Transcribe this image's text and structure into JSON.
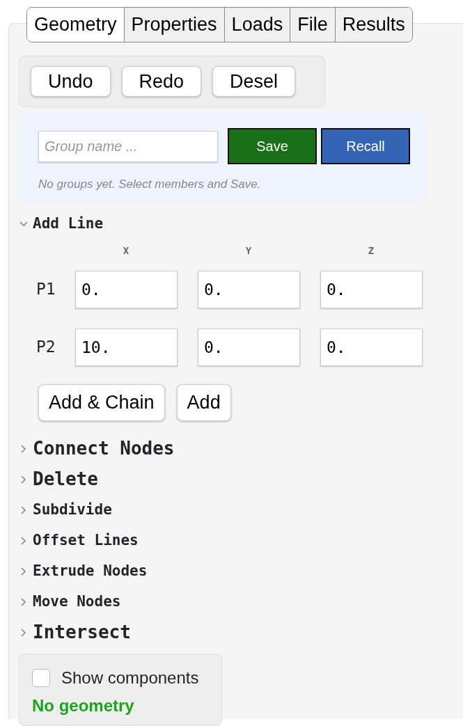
{
  "tabs": [
    {
      "label": "Geometry",
      "selected": true
    },
    {
      "label": "Properties",
      "selected": false
    },
    {
      "label": "Loads",
      "selected": false
    },
    {
      "label": "File",
      "selected": false
    },
    {
      "label": "Results",
      "selected": false
    }
  ],
  "history_buttons": [
    "Undo",
    "Redo",
    "Desel"
  ],
  "groups": {
    "placeholder": "Group name ...",
    "save": "Save",
    "recall": "Recall",
    "hint": "No groups yet. Select members and Save."
  },
  "add_line": {
    "title": "Add Line",
    "expanded": true,
    "columns": [
      "X",
      "Y",
      "Z"
    ],
    "points": [
      {
        "label": "P1",
        "values": [
          "0.",
          "0.",
          "0."
        ]
      },
      {
        "label": "P2",
        "values": [
          "10.",
          "0.",
          "0."
        ]
      }
    ],
    "buttons": [
      "Add & Chain",
      "Add"
    ]
  },
  "sections": [
    {
      "title": "Connect Nodes",
      "kind": "large",
      "expanded": false
    },
    {
      "title": "Delete",
      "kind": "large",
      "expanded": false
    },
    {
      "title": "Subdivide",
      "kind": "small",
      "expanded": false
    },
    {
      "title": "Offset Lines",
      "kind": "small",
      "expanded": false
    },
    {
      "title": "Extrude Nodes",
      "kind": "small",
      "expanded": false
    },
    {
      "title": "Move Nodes",
      "kind": "small",
      "expanded": false
    },
    {
      "title": "Intersect",
      "kind": "large",
      "expanded": false
    }
  ],
  "footer": {
    "show_components": {
      "label": "Show components",
      "checked": false
    },
    "status": "No geometry"
  }
}
